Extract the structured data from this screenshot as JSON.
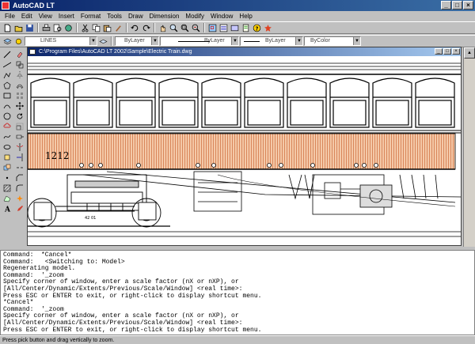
{
  "window": {
    "title": "AutoCAD LT"
  },
  "menu": [
    "File",
    "Edit",
    "View",
    "Insert",
    "Format",
    "Tools",
    "Draw",
    "Dimension",
    "Modify",
    "Window",
    "Help"
  ],
  "layers": {
    "layer_value": "LINES",
    "color_value": "ByLayer",
    "linetype_value": "ByLayer",
    "lineweight_value": "ByLayer",
    "plotstyle_value": "ByColor"
  },
  "document": {
    "title": "C:\\Program Files\\AutoCAD LT 2002\\Sample\\Electric Train.dwg",
    "car_number": "1212",
    "truck_label": "42 01"
  },
  "command_history": [
    "Command:  *Cancel*",
    "Command:   <Switching to: Model>",
    "Regenerating model.",
    "Command:  '_zoom",
    "Specify corner of window, enter a scale factor (nX or nXP), or",
    "[All/Center/Dynamic/Extents/Previous/Scale/Window] <real time>:",
    "Press ESC or ENTER to exit, or right-click to display shortcut menu.",
    "*Cancel*",
    "Command:  '_zoom",
    "Specify corner of window, enter a scale factor (nX or nXP), or",
    "[All/Center/Dynamic/Extents/Previous/Scale/Window] <real time>:",
    "Press ESC or ENTER to exit, or right-click to display shortcut menu."
  ],
  "status": {
    "text": "Press pick button and drag vertically to zoom."
  },
  "colors": {
    "title_bar": "#0a246a",
    "car_body_stripes": "#e9a77f",
    "face": "#c0c0c0"
  }
}
